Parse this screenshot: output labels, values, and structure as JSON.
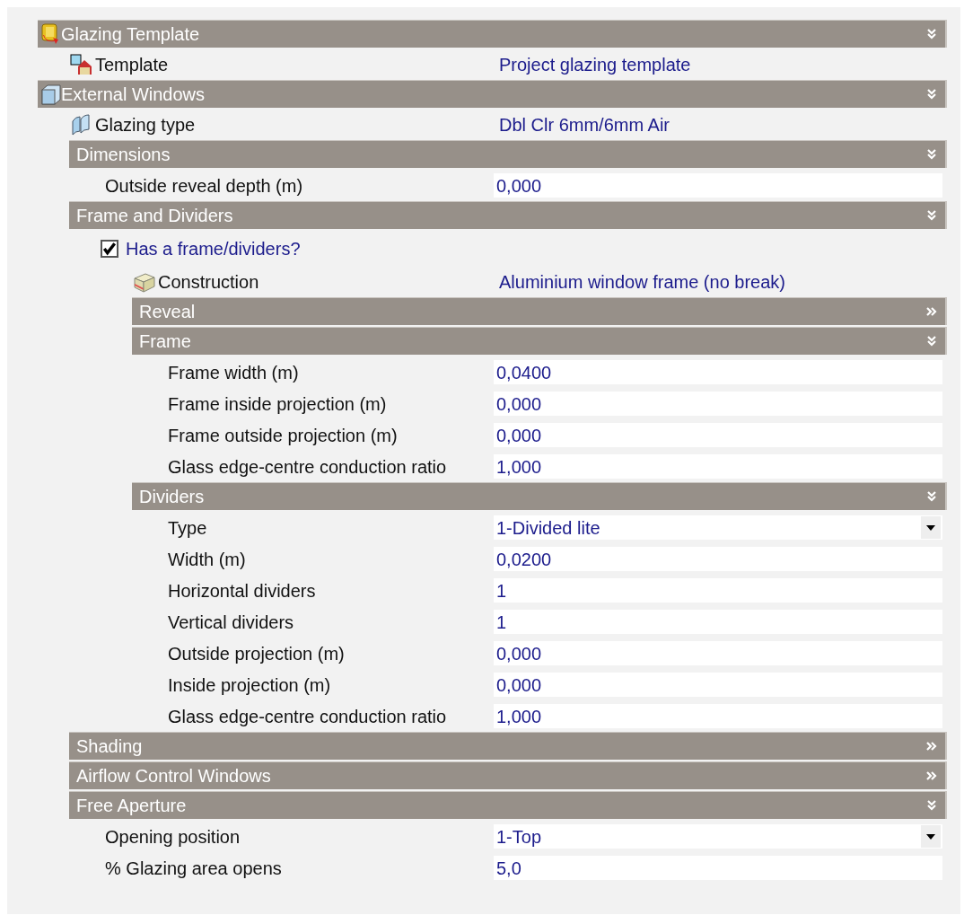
{
  "sections": [
    {
      "kind": "header",
      "title": "Glazing Template",
      "expanded": true,
      "children": [
        {
          "kind": "link",
          "label": "Template",
          "value": "Project glazing template"
        }
      ]
    },
    {
      "kind": "header",
      "title": "External Windows",
      "expanded": true,
      "children": [
        {
          "kind": "link",
          "label": "Glazing type",
          "value": "Dbl Clr 6mm/6mm Air"
        },
        {
          "kind": "header",
          "title": "Dimensions",
          "expanded": true,
          "children": [
            {
              "kind": "field",
              "label": "Outside reveal depth (m)",
              "value": "0,000"
            }
          ]
        },
        {
          "kind": "header",
          "title": "Frame and Dividers",
          "expanded": true,
          "children": [
            {
              "kind": "checkbox",
              "label": "Has a frame/dividers?",
              "checked": true,
              "children": [
                {
                  "kind": "link",
                  "label": "Construction",
                  "value": "Aluminium window frame (no break)"
                },
                {
                  "kind": "header",
                  "title": "Reveal",
                  "expanded": false
                },
                {
                  "kind": "header",
                  "title": "Frame",
                  "expanded": true,
                  "children": [
                    {
                      "kind": "field",
                      "label": "Frame width (m)",
                      "value": "0,0400"
                    },
                    {
                      "kind": "field",
                      "label": "Frame inside projection (m)",
                      "value": "0,000"
                    },
                    {
                      "kind": "field",
                      "label": "Frame outside projection (m)",
                      "value": "0,000"
                    },
                    {
                      "kind": "field",
                      "label": "Glass edge-centre conduction ratio",
                      "value": "1,000"
                    }
                  ]
                },
                {
                  "kind": "header",
                  "title": "Dividers",
                  "expanded": true,
                  "children": [
                    {
                      "kind": "dropdown",
                      "label": "Type",
                      "value": "1-Divided lite"
                    },
                    {
                      "kind": "field",
                      "label": "Width (m)",
                      "value": "0,0200"
                    },
                    {
                      "kind": "field",
                      "label": "Horizontal dividers",
                      "value": "1"
                    },
                    {
                      "kind": "field",
                      "label": "Vertical dividers",
                      "value": "1"
                    },
                    {
                      "kind": "field",
                      "label": "Outside projection (m)",
                      "value": "0,000"
                    },
                    {
                      "kind": "field",
                      "label": "Inside projection (m)",
                      "value": "0,000"
                    },
                    {
                      "kind": "field",
                      "label": "Glass edge-centre conduction ratio",
                      "value": "1,000"
                    }
                  ]
                }
              ]
            }
          ]
        },
        {
          "kind": "header",
          "title": "Shading",
          "expanded": false
        },
        {
          "kind": "header",
          "title": "Airflow Control Windows",
          "expanded": false
        },
        {
          "kind": "header",
          "title": "Free Aperture",
          "expanded": true,
          "children": [
            {
              "kind": "dropdown",
              "label": "Opening position",
              "value": "1-Top"
            },
            {
              "kind": "field",
              "label": "% Glazing area opens",
              "value": "5,0"
            }
          ]
        }
      ]
    }
  ]
}
